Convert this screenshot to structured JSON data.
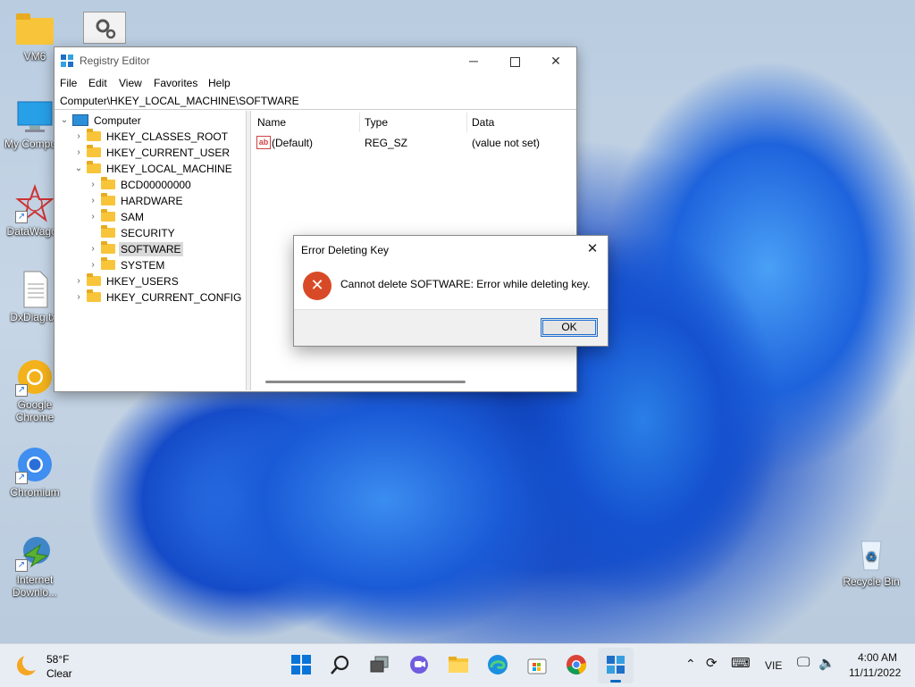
{
  "desktop": {
    "icons": [
      {
        "label": "VM6"
      },
      {
        "label": "My Compu..."
      },
      {
        "label": "DataWagon"
      },
      {
        "label": "DxDiag.txt"
      },
      {
        "label": "Google Chrome"
      },
      {
        "label": "Chromium"
      },
      {
        "label": "Internet Downlo..."
      },
      {
        "label": "Recycle Bin"
      }
    ]
  },
  "regedit": {
    "title": "Registry Editor",
    "menu": [
      "File",
      "Edit",
      "View",
      "Favorites",
      "Help"
    ],
    "address": "Computer\\HKEY_LOCAL_MACHINE\\SOFTWARE",
    "tree": {
      "root": "Computer",
      "hives": [
        "HKEY_CLASSES_ROOT",
        "HKEY_CURRENT_USER",
        "HKEY_LOCAL_MACHINE",
        "HKEY_USERS",
        "HKEY_CURRENT_CONFIG"
      ],
      "hklm_children": [
        "BCD00000000",
        "HARDWARE",
        "SAM",
        "SECURITY",
        "SOFTWARE",
        "SYSTEM"
      ],
      "selected": "SOFTWARE"
    },
    "columns": {
      "name": "Name",
      "type": "Type",
      "data": "Data"
    },
    "rows": [
      {
        "name": "(Default)",
        "type": "REG_SZ",
        "data": "(value not set)"
      }
    ]
  },
  "dialog": {
    "title": "Error Deleting Key",
    "message": "Cannot delete SOFTWARE:  Error while deleting key.",
    "ok_label": "OK"
  },
  "taskbar": {
    "weather": {
      "temp": "58°F",
      "condition": "Clear"
    },
    "language": "VIE",
    "time": "4:00 AM",
    "date": "11/11/2022"
  },
  "colors": {
    "accent": "#0067c0",
    "error": "#d84a27",
    "folder": "#f8c53a"
  }
}
